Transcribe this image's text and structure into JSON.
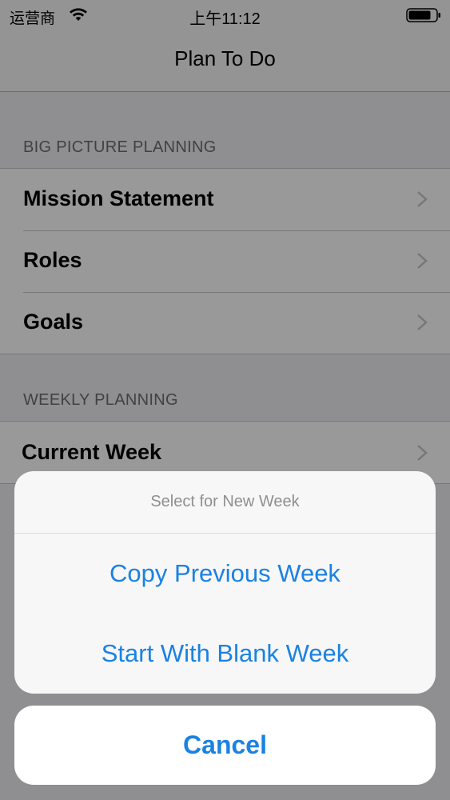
{
  "status_bar": {
    "carrier": "运营商",
    "time": "上午11:12",
    "icons": [
      "wifi-icon",
      "battery-icon"
    ]
  },
  "nav": {
    "title": "Plan To Do"
  },
  "sections": [
    {
      "header": "BIG PICTURE PLANNING",
      "items": [
        {
          "label": "Mission Statement",
          "icon": "chevron-right-icon"
        },
        {
          "label": "Roles",
          "icon": "chevron-right-icon"
        },
        {
          "label": "Goals",
          "icon": "chevron-right-icon"
        }
      ]
    },
    {
      "header": "WEEKLY PLANNING",
      "items": [
        {
          "label": "Current Week",
          "icon": "chevron-right-icon"
        }
      ]
    }
  ],
  "action_sheet": {
    "title": "Select for New Week",
    "actions": [
      {
        "label": "Copy Previous Week"
      },
      {
        "label": "Start With Blank Week"
      }
    ],
    "cancel_label": "Cancel"
  },
  "colors": {
    "accent": "#1a82e2",
    "background": "#efeff4",
    "overlay": "rgba(0,0,0,0.40)"
  }
}
